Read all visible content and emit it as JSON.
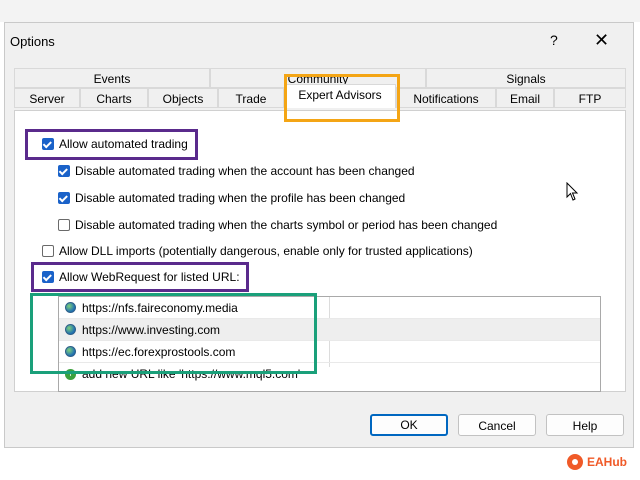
{
  "window": {
    "title": "Options",
    "help_glyph": "?",
    "close_glyph": "✕"
  },
  "tabs_back": [
    "Events",
    "Community",
    "Signals"
  ],
  "tabs_front": [
    "Server",
    "Charts",
    "Objects",
    "Trade",
    "Expert Advisors",
    "Notifications",
    "Email",
    "FTP"
  ],
  "selected_tab": "Expert Advisors",
  "options": [
    {
      "label": "Allow automated trading",
      "checked": true
    },
    {
      "label": "Disable automated trading when the account has been changed",
      "checked": true
    },
    {
      "label": "Disable automated trading when the profile has been changed",
      "checked": true
    },
    {
      "label": "Disable automated trading when the charts symbol or period has been changed",
      "checked": false
    },
    {
      "label": "Allow DLL imports (potentially dangerous, enable only for trusted applications)",
      "checked": false
    },
    {
      "label": "Allow WebRequest for listed URL:",
      "checked": true
    }
  ],
  "url_list": {
    "urls": [
      "https://nfs.faireconomy.media",
      "https://www.investing.com",
      "https://ec.forexprostools.com"
    ],
    "add_placeholder": "add new URL like 'https://www.mql5.com'"
  },
  "buttons": {
    "ok": "OK",
    "cancel": "Cancel",
    "help": "Help"
  },
  "watermark": {
    "text": "EAHub"
  },
  "highlight_colors": {
    "purple": "#5a2a8c",
    "orange": "#f4a515",
    "green": "#1aa07a"
  }
}
